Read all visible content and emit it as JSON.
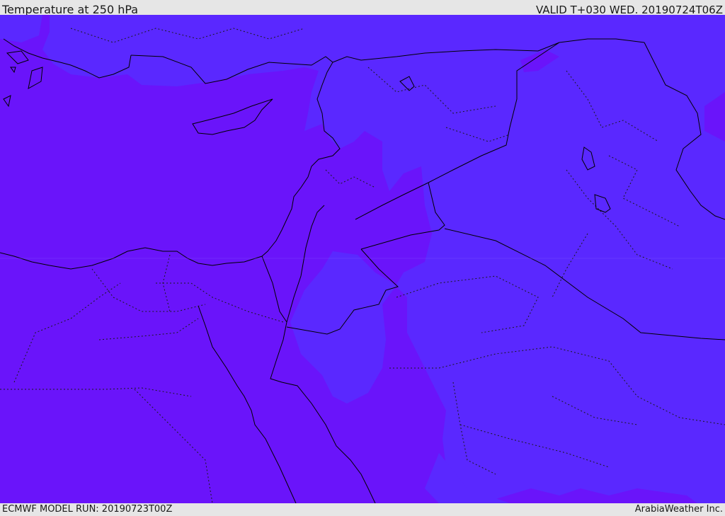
{
  "header": {
    "title": "Temperature at 250 hPa",
    "valid": "VALID T+030 WED. 20190724T06Z"
  },
  "footer": {
    "model_run": "ECMWF MODEL RUN: 20190723T00Z",
    "credit": "ArabiaWeather Inc."
  },
  "map": {
    "field": "temperature",
    "level": "250 hPa",
    "colors": {
      "colder_band": "#6a14fa",
      "warmer_band": "#5a28ff",
      "coastline": "#000000",
      "borders": "#000000",
      "provinces": "#1a1a1a"
    }
  }
}
